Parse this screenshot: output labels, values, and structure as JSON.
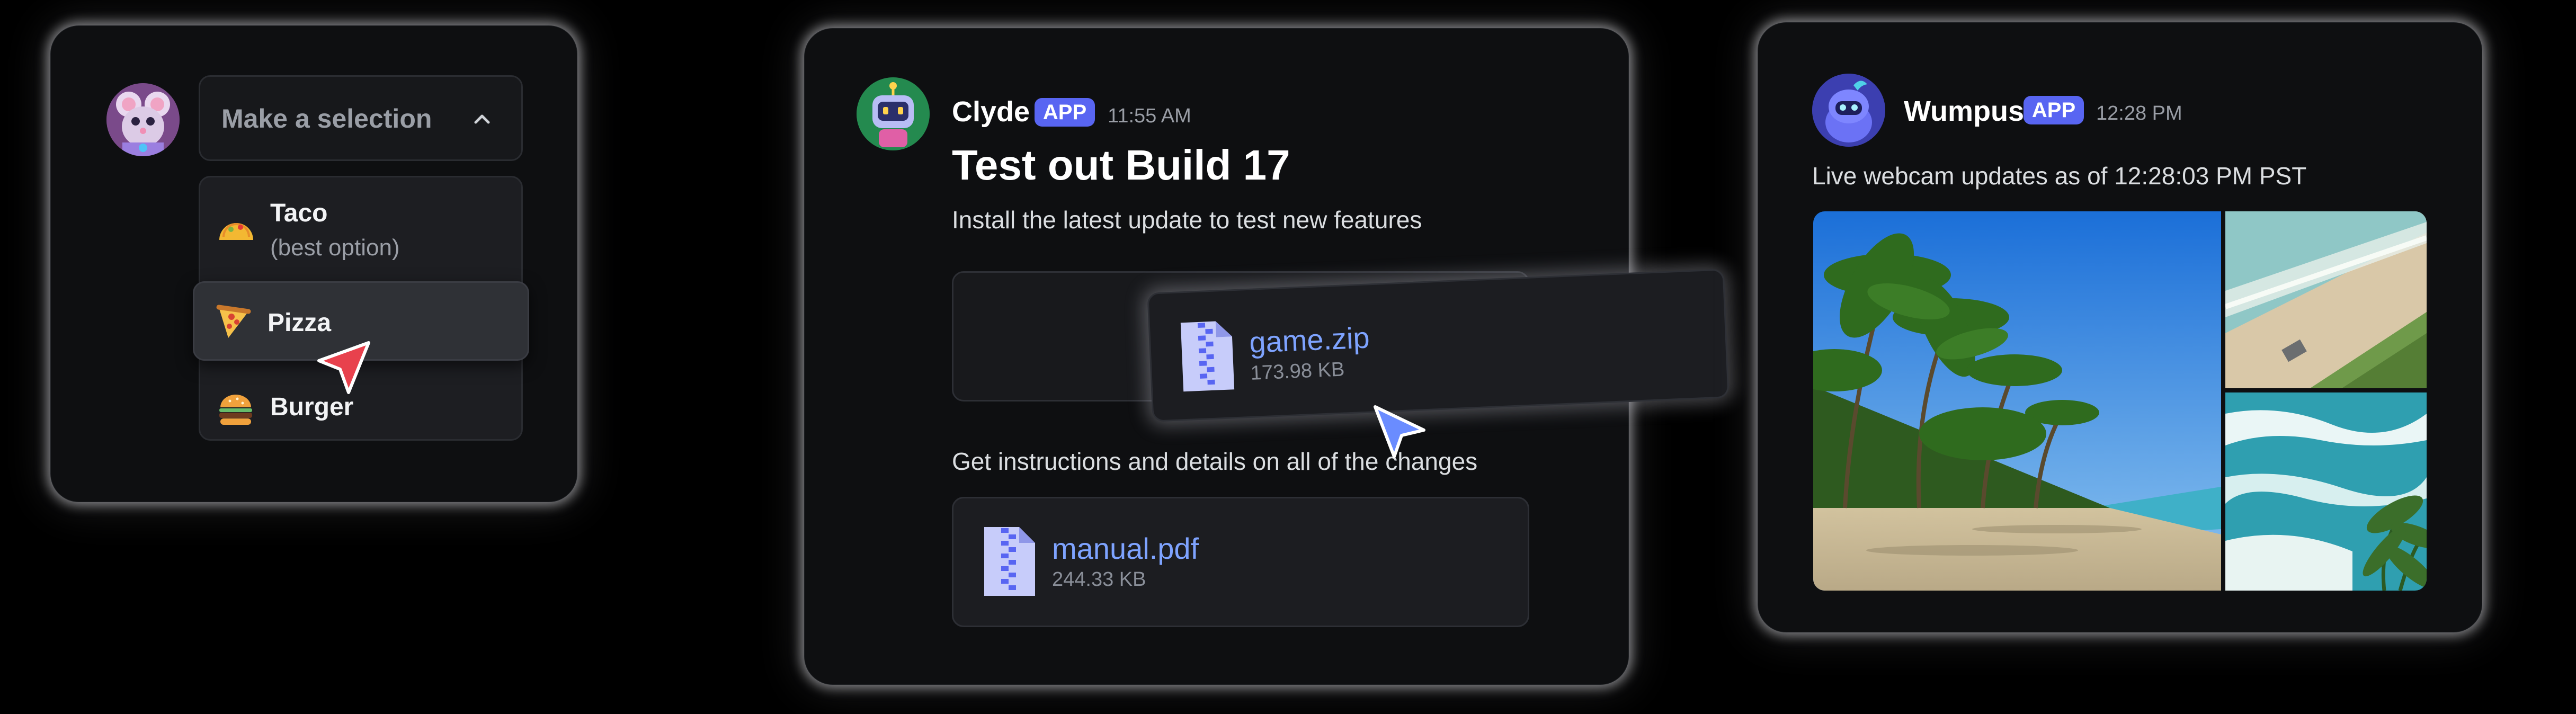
{
  "select_card": {
    "placeholder": "Make a selection",
    "options": [
      {
        "emoji": "taco-icon",
        "label": "Taco",
        "description": "(best option)"
      },
      {
        "emoji": "pizza-icon",
        "label": "Pizza"
      },
      {
        "emoji": "burger-icon",
        "label": "Burger"
      }
    ],
    "hovered_option": "Pizza"
  },
  "clyde_card": {
    "username": "Clyde",
    "badge": "APP",
    "time": "11:55 AM",
    "title": "Test out Build 17",
    "description": "Install the latest update to test new features",
    "dragged_file": {
      "name": "game.zip",
      "size": "173.98 KB"
    },
    "instructions": "Get instructions and details on all of the changes",
    "file": {
      "name": "manual.pdf",
      "size": "244.33 KB"
    }
  },
  "wumpus_card": {
    "username": "Wumpus",
    "badge": "APP",
    "time": "12:28 PM",
    "message": "Live webcam updates as of 12:28:03 PM PST",
    "images": [
      "beach-palms-image",
      "aerial-beach-image",
      "waves-image"
    ]
  },
  "colors": {
    "accent": "#5865f2",
    "link": "#7ea3ff",
    "cursor_red": "#e8414d",
    "cursor_blue": "#6a8cff",
    "card_bg": "#0e0f11"
  }
}
